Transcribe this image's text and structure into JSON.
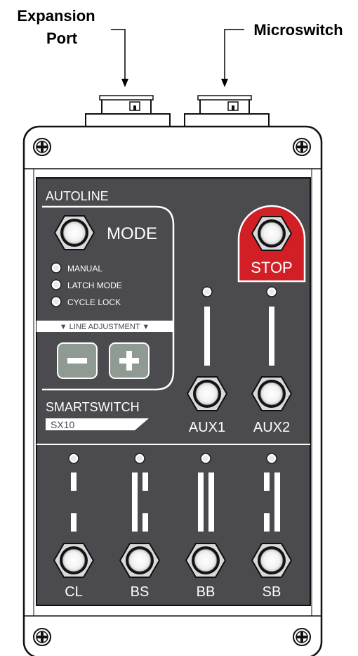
{
  "callouts": {
    "expansion_port_line1": "Expansion",
    "expansion_port_line2": "Port",
    "microswitch": "Microswitch"
  },
  "panel": {
    "brand": "AUTOLINE",
    "mode_label": "MODE",
    "mode_options": [
      "MANUAL",
      "LATCH MODE",
      "CYCLE LOCK"
    ],
    "line_adjustment": "▼ LINE ADJUSTMENT ▼",
    "minus": "−",
    "plus": "+",
    "stop_label": "STOP",
    "product_name": "SMARTSWITCH",
    "model": "SX10",
    "aux_labels": [
      "AUX1",
      "AUX2"
    ],
    "bottom_labels": [
      "CL",
      "BS",
      "BB",
      "SB"
    ]
  },
  "colors": {
    "panel_bg": "#4a4a4f",
    "stop_red": "#d21f26",
    "button_green": "#8f9a92"
  }
}
